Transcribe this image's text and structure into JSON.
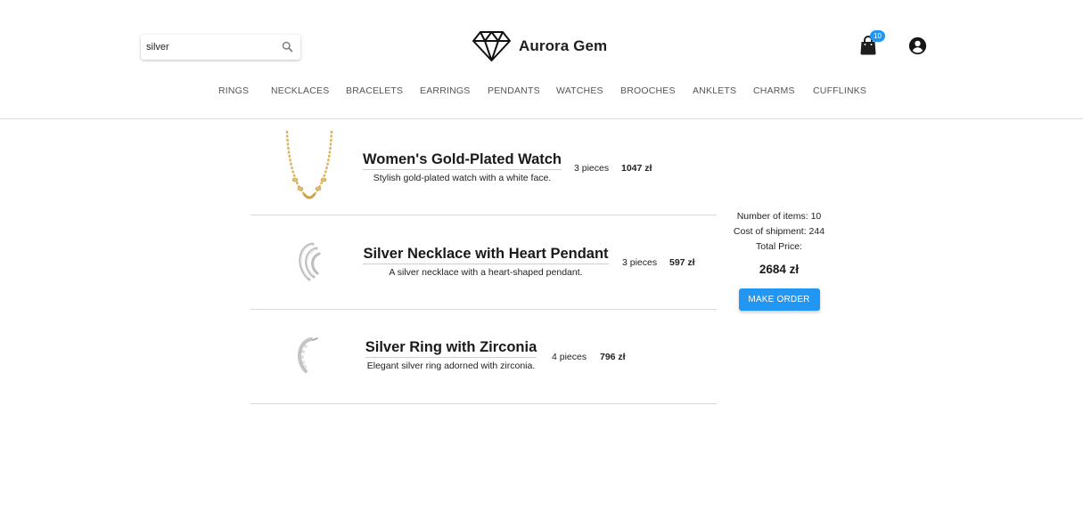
{
  "search": {
    "value": "silver",
    "placeholder": ""
  },
  "brand": {
    "name": "Aurora Gem"
  },
  "cart": {
    "badge_count": "10"
  },
  "nav": [
    "RINGS",
    "NECKLACES",
    "BRACELETS",
    "EARRINGS",
    "PENDANTS",
    "WATCHES",
    "BROOCHES",
    "ANKLETS",
    "CHARMS",
    "CUFFLINKS"
  ],
  "cart_items": [
    {
      "title": "Women's Gold-Plated Watch",
      "description": "Stylish gold-plated watch with a white face.",
      "quantity": "3 pieces",
      "price": "1047 zł",
      "image": "gold-chain-necklace"
    },
    {
      "title": "Silver Necklace with Heart Pendant",
      "description": "A silver necklace with a heart-shaped pendant.",
      "quantity": "3 pieces",
      "price": "597 zł",
      "image": "silver-ear-cuff"
    },
    {
      "title": "Silver Ring with Zirconia",
      "description": "Elegant silver ring adorned with zirconia.",
      "quantity": "4 pieces",
      "price": "796 zł",
      "image": "silver-zirconia-earring"
    }
  ],
  "summary": {
    "items_line": "Number of items: 10",
    "shipment_line": "Cost of shipment: 244",
    "total_label": "Total Price:",
    "total_value": "2684 zł",
    "order_button": "MAKE ORDER"
  },
  "colors": {
    "accent": "#2196f3",
    "gold": "#d9b45a",
    "silver": "#c4c4c4"
  },
  "icons": {
    "search": "search-icon",
    "logo": "diamond-logo-icon",
    "cart": "shopping-bag-icon",
    "account": "account-circle-icon"
  }
}
